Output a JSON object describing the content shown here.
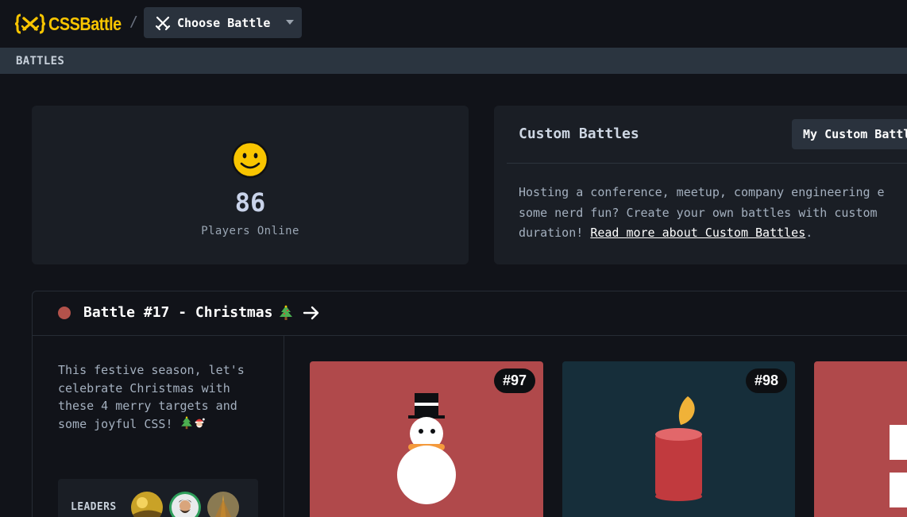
{
  "header": {
    "logo_text": "CSSBattle",
    "breadcrumb_separator": "/",
    "choose_battle_label": "Choose Battle"
  },
  "section": {
    "title": "BATTLES"
  },
  "players": {
    "count": "86",
    "label": "Players Online"
  },
  "custom_battles": {
    "title": "Custom Battles",
    "button_label": "My Custom Battles",
    "desc_line1": "Hosting a conference, meetup, company engineering e",
    "desc_line2": "some nerd fun? Create your own battles with custom ",
    "desc_line3_prefix": "duration! ",
    "link_text": "Read more about Custom Battles",
    "desc_line3_suffix": "."
  },
  "battle": {
    "title": "Battle #17 - Christmas",
    "status_color": "#b3524b",
    "description": "This festive season, let's celebrate Christmas with these 4 merry targets and some joyful CSS!",
    "leaders_label": "LEADERS",
    "targets": [
      {
        "badge": "#97",
        "bg": "#b0494b"
      },
      {
        "badge": "#98",
        "bg": "#162e3a"
      },
      {
        "badge": "",
        "bg": "#b0494b"
      }
    ]
  },
  "colors": {
    "accent": "#f9c500",
    "background": "#111319",
    "card": "#1a1e25"
  }
}
